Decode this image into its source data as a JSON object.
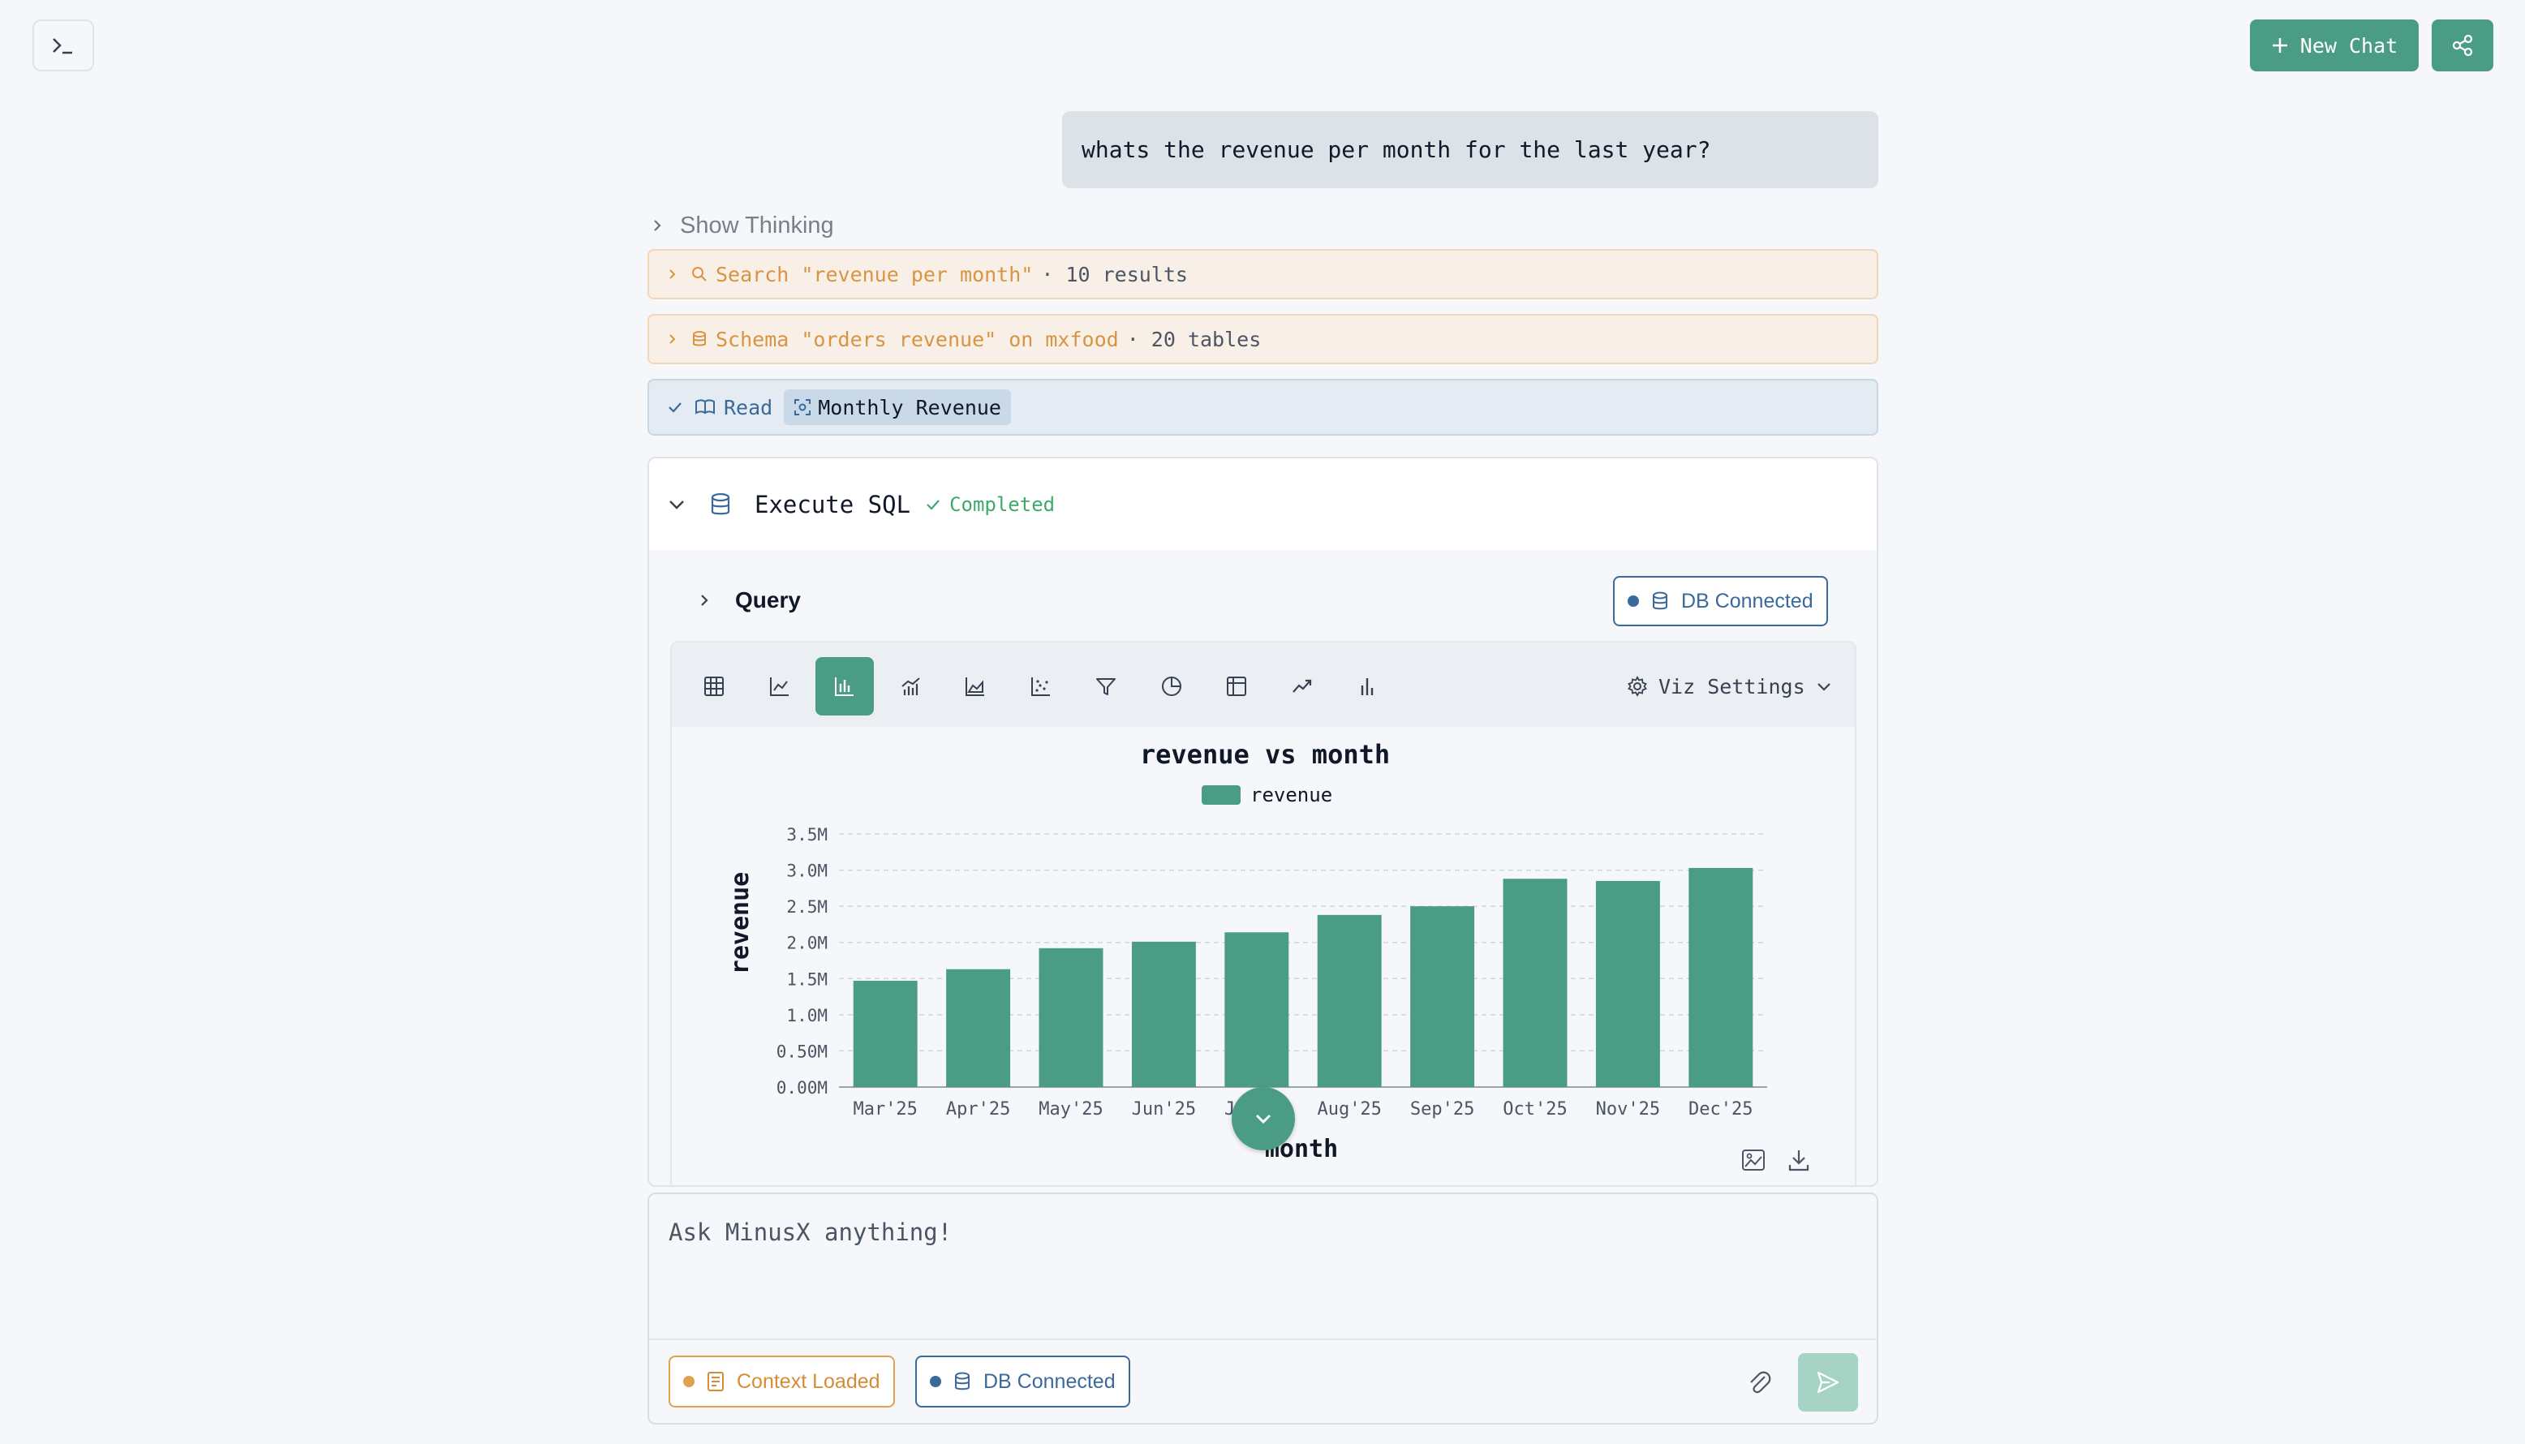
{
  "header": {
    "new_chat_label": "New Chat"
  },
  "user_message": "whats the revenue per month for the last year?",
  "thinking": {
    "label": "Show Thinking"
  },
  "tools": {
    "search": {
      "query": "Search \"revenue per month\"",
      "meta": "· 10 results"
    },
    "schema": {
      "query": "Schema \"orders revenue\" on mxfood",
      "meta": "· 20 tables"
    },
    "read": {
      "label": "Read",
      "chip": "Monthly Revenue"
    }
  },
  "sql": {
    "title": "Execute SQL",
    "status": "Completed",
    "query_label": "Query",
    "db_status": "DB Connected"
  },
  "viz": {
    "settings_label": "Viz Settings",
    "icons": [
      "table-icon",
      "line-chart-icon",
      "bar-chart-icon",
      "combo-chart-icon",
      "area-chart-icon",
      "scatter-chart-icon",
      "funnel-icon",
      "pie-chart-icon",
      "pivot-table-icon",
      "trend-icon",
      "column-chart-icon"
    ],
    "active_index": 2
  },
  "chart_data": {
    "type": "bar",
    "title": "revenue vs month",
    "xlabel": "month",
    "ylabel": "revenue",
    "categories": [
      "Mar'25",
      "Apr'25",
      "May'25",
      "Jun'25",
      "Jul'25",
      "Aug'25",
      "Sep'25",
      "Oct'25",
      "Nov'25",
      "Dec'25"
    ],
    "series": [
      {
        "name": "revenue",
        "values": [
          1.47,
          1.63,
          1.92,
          2.01,
          2.14,
          2.38,
          2.5,
          2.88,
          2.85,
          3.03
        ]
      }
    ],
    "yticks": [
      "0.00M",
      "0.50M",
      "1.0M",
      "1.5M",
      "2.0M",
      "2.5M",
      "3.0M",
      "3.5M"
    ],
    "ylim": [
      0,
      3.5
    ],
    "legend": "top-center",
    "grid": true,
    "color": "#4a9d84"
  },
  "input": {
    "placeholder": "Ask MinusX anything!",
    "context_label": "Context Loaded",
    "db_label": "DB Connected"
  },
  "colors": {
    "accent": "#4a9d84",
    "warning": "#e0a24f",
    "info": "#3b6a9a",
    "success": "#3fa96b"
  }
}
